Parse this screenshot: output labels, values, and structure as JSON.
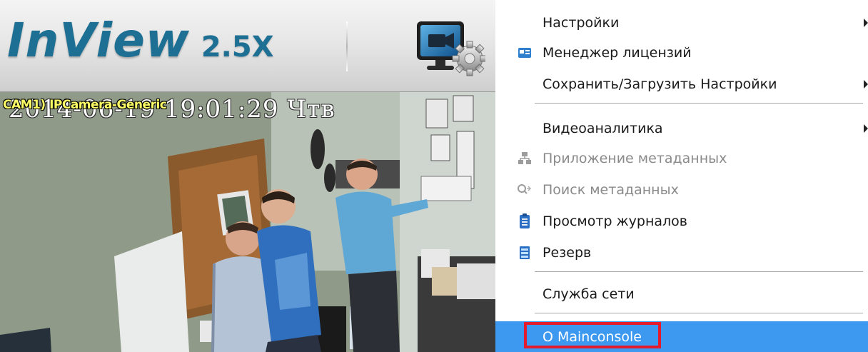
{
  "app": {
    "brand_name": "InView",
    "brand_version": "2.5X",
    "settings_icon": "video-settings-icon"
  },
  "camera": {
    "timestamp_overlay": "2014-06-19 19:01:29 Чтв",
    "label_overlay": "CAM1) IPCamera-Generic"
  },
  "menu": {
    "items": [
      {
        "label": "Настройки",
        "icon": "",
        "submenu": true,
        "disabled": false
      },
      {
        "label": "Менеджер лицензий",
        "icon": "license-card-icon",
        "submenu": false,
        "disabled": false
      },
      {
        "label": "Сохранить/Загрузить Настройки",
        "icon": "",
        "submenu": true,
        "disabled": false
      },
      {
        "label": "Видеоаналитика",
        "icon": "",
        "submenu": true,
        "disabled": false
      },
      {
        "label": "Приложение метаданных",
        "icon": "network-metadata-icon",
        "submenu": false,
        "disabled": true
      },
      {
        "label": "Поиск метаданных",
        "icon": "search-metadata-icon",
        "submenu": false,
        "disabled": true
      },
      {
        "label": "Просмотр журналов",
        "icon": "clipboard-log-icon",
        "submenu": false,
        "disabled": false
      },
      {
        "label": "Резерв",
        "icon": "backup-icon",
        "submenu": false,
        "disabled": false
      },
      {
        "label": "Служба сети",
        "icon": "",
        "submenu": false,
        "disabled": false
      },
      {
        "label": "О Mainconsole",
        "icon": "",
        "submenu": false,
        "disabled": false,
        "highlighted": true
      }
    ]
  },
  "colors": {
    "brand": "#1d6f93",
    "menu_highlight": "#3d98f0",
    "annotation_box": "#e31b2c"
  }
}
